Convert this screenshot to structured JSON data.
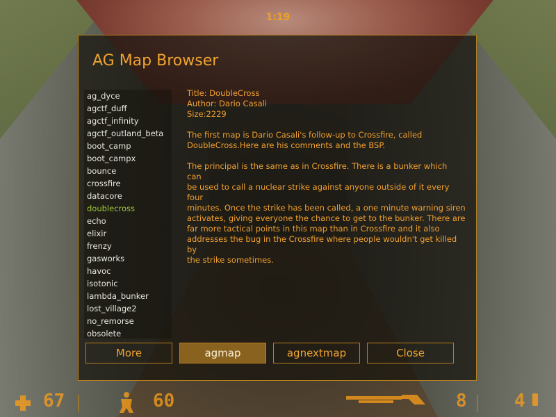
{
  "timer": "1:19",
  "panel": {
    "title": "AG Map Browser",
    "maps": [
      "ag_dyce",
      "agctf_duff",
      "agctf_infinity",
      "agctf_outland_beta",
      "boot_camp",
      "boot_campx",
      "bounce",
      "crossfire",
      "datacore",
      "doublecross",
      "echo",
      "elixir",
      "frenzy",
      "gasworks",
      "havoc",
      "isotonic",
      "lambda_bunker",
      "lost_village2",
      "no_remorse",
      "obsolete"
    ],
    "selected_map": "doublecross",
    "details": {
      "title_line": "Title:  DoubleCross",
      "author_line": "Author: Dario Casali",
      "size_line": "Size:2229",
      "desc_lines_1": [
        "The first map is Dario Casali's follow-up to Crossfire, called",
        "DoubleCross.Here are his comments and the BSP."
      ],
      "desc_lines_2": [
        "The principal is the same as in Crossfire. There is a bunker which",
        "can",
        "be used to call a nuclear strike against anyone outside of it every",
        "four",
        "minutes. Once the strike has been called, a one minute warning siren",
        "activates, giving everyone the chance to get to the bunker. There are",
        "far more tactical points in this map than in Crossfire and it also",
        "addresses the bug in the Crossfire where people wouldn't get killed",
        "by",
        "the strike sometimes."
      ]
    },
    "buttons": {
      "more": "More",
      "agmap": "agmap",
      "agnextmap": "agnextmap",
      "close": "Close"
    }
  },
  "hud": {
    "health": "67",
    "armor": "60",
    "clip": "8",
    "ammo": "4"
  },
  "icons": {
    "health": "cross-icon",
    "armor": "suit-icon",
    "weapon": "shotgun-icon",
    "ammo": "shell-icon"
  },
  "colors": {
    "accent": "#f0a430",
    "selected": "#9ec63a",
    "hud": "#ffa018"
  }
}
